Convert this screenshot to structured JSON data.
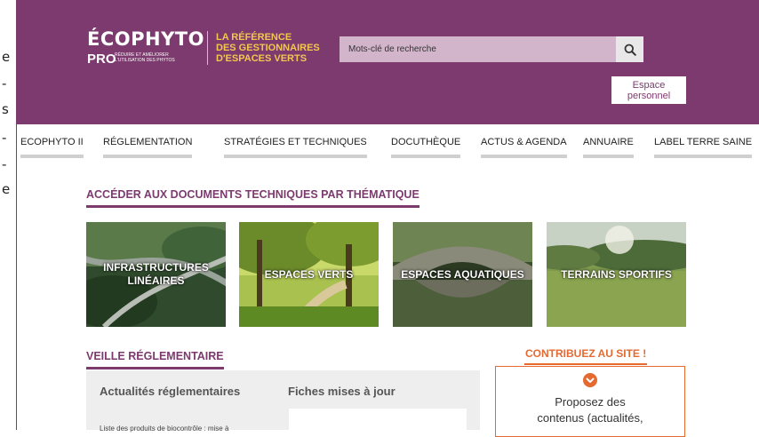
{
  "left_strip": {
    "glyphs": [
      "e",
      "-",
      "s",
      "-",
      "-",
      "e"
    ]
  },
  "header": {
    "logo": {
      "main": "ÉCOPHYTO",
      "pro": "PRO",
      "small_line1": "RÉDUIRE ET AMÉLIORER",
      "small_line2": "L'UTILISATION DES PHYTOS"
    },
    "tagline": {
      "line1": "LA RÉFÉRENCE",
      "line2": "DES GESTIONNAIRES",
      "line3": "D'ESPACES VERTS"
    },
    "search": {
      "placeholder": "Mots-clé de recherche"
    },
    "espace_personnel": {
      "line1": "Espace",
      "line2": "personnel"
    },
    "colors": {
      "background": "#7c3a6e",
      "accent": "#f3c74e"
    }
  },
  "nav": {
    "items": [
      {
        "label": "ECOPHYTO II"
      },
      {
        "label": "RÉGLEMENTATION"
      },
      {
        "label": "STRATÉGIES ET TECHNIQUES"
      },
      {
        "label": "DOCUTHÈQUE"
      },
      {
        "label": "ACTUS & AGENDA"
      },
      {
        "label": "ANNUAIRE"
      },
      {
        "label": "LABEL TERRE SAINE"
      }
    ]
  },
  "main": {
    "thematique_title": "ACCÉDER AUX DOCUMENTS TECHNIQUES PAR THÉMATIQUE",
    "tiles": [
      {
        "line1": "INFRASTRUCTURES",
        "line2": "LINÉAIRES"
      },
      {
        "line1": "ESPACES VERTS",
        "line2": ""
      },
      {
        "line1": "ESPACES AQUATIQUES",
        "line2": ""
      },
      {
        "line1": "TERRAINS SPORTIFS",
        "line2": ""
      }
    ],
    "veille_title": "VEILLE RÉGLEMENTAIRE",
    "actualites_title": "Actualités réglementaires",
    "fiches_title": "Fiches mises à jour",
    "actualites_snippet": "Liste des produits de biocontrôle : mise à"
  },
  "contrib": {
    "title": "CONTRIBUEZ AU SITE !",
    "line1": "Proposez des",
    "line2": "contenus (actualités,",
    "icon": "arrow-down-circle-icon",
    "color": "#e46a32"
  }
}
